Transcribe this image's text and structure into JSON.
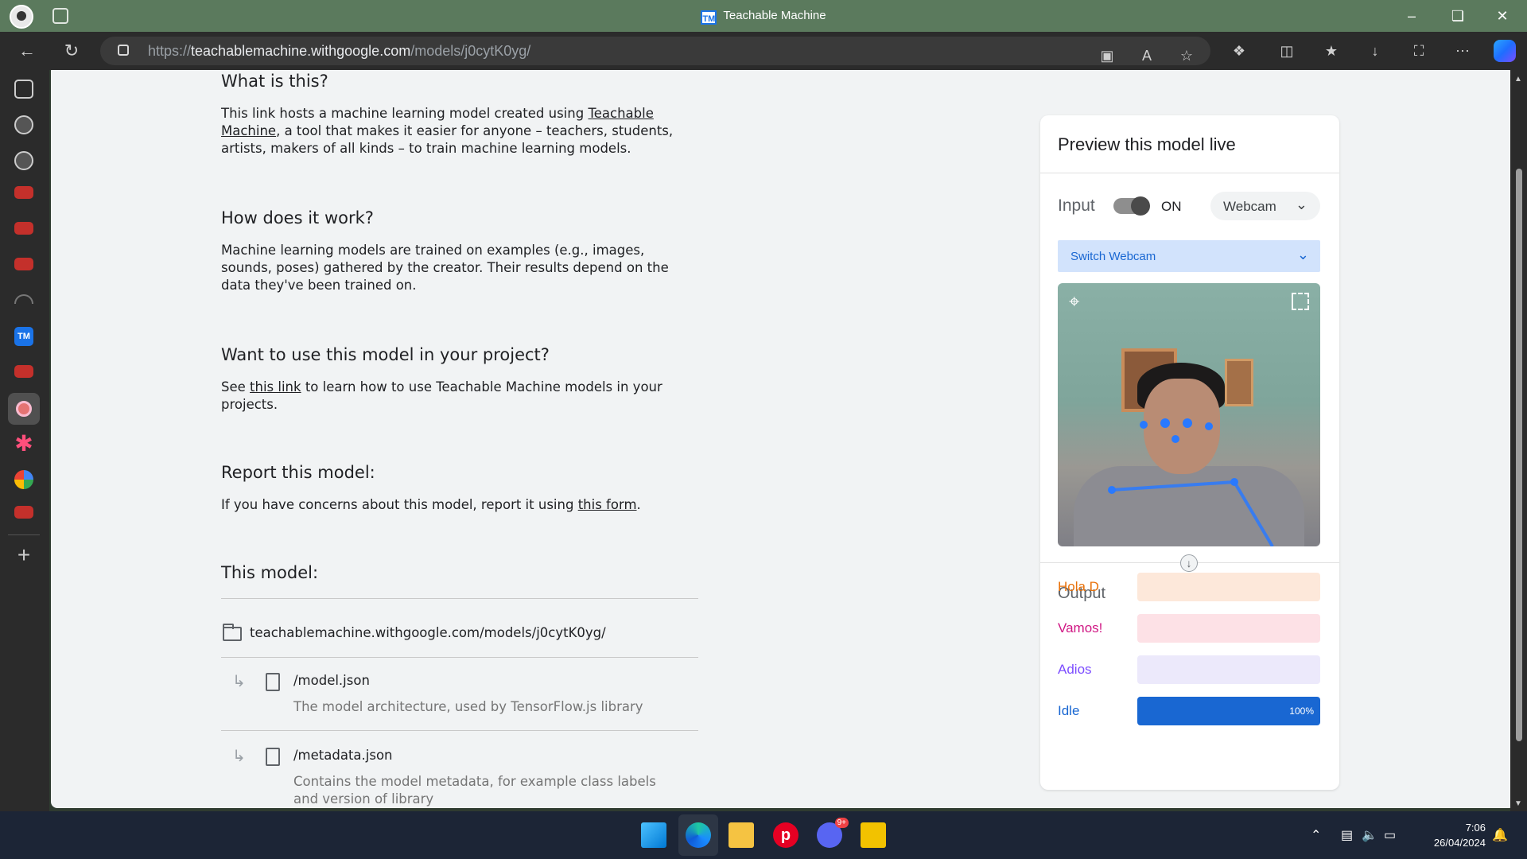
{
  "window": {
    "title": "Teachable Machine",
    "favicon_text": "TM"
  },
  "browser": {
    "url_prefix": "https://",
    "url_host": "teachablemachine.withgoogle.com",
    "url_path": "/models/j0cytK0yg/"
  },
  "sidebar": {
    "icons": [
      "collections-icon",
      "github-icon",
      "github-icon",
      "youtube-icon",
      "youtube-icon",
      "youtube-icon",
      "headphones-icon",
      "teachable-machine-icon",
      "youtube-icon",
      "record-icon",
      "asterisk-icon",
      "google-icon",
      "youtube-icon",
      "add-icon"
    ]
  },
  "content": {
    "what_heading": "What is this?",
    "what_text_1": "This link hosts a machine learning model created using ",
    "what_link": "Teachable Machine",
    "what_text_2": ", a tool that makes it easier for anyone – teachers, students, artists, makers of all kinds – to train machine learning models.",
    "how_heading": "How does it work?",
    "how_text": "Machine learning models are trained on examples (e.g., images, sounds, poses) gathered by the creator. Their results depend on the data they've been trained on.",
    "use_heading": "Want to use this model in your project?",
    "use_text_1": "See ",
    "use_link": "this link",
    "use_text_2": " to learn how to use Teachable Machine models in your projects.",
    "report_heading": "Report this model:",
    "report_text_1": "If you have concerns about this model, report it using ",
    "report_link": "this form",
    "report_text_2": ".",
    "model_heading": "This model:",
    "model_url": "teachablemachine.withgoogle.com/models/j0cytK0yg/",
    "files": [
      {
        "name": "/model.json",
        "desc": "The model architecture, used by TensorFlow.js library"
      },
      {
        "name": "/metadata.json",
        "desc": "Contains the model metadata, for example class labels and version of library"
      }
    ]
  },
  "preview": {
    "title": "Preview this model live",
    "input_label": "Input",
    "toggle_state": "ON",
    "source_select": "Webcam",
    "switch_webcam": "Switch Webcam",
    "output_label": "Output",
    "classes": [
      {
        "label": "Hola D",
        "color": "#e8710a",
        "bg": "#fde8da",
        "value": 0,
        "pct_text": ""
      },
      {
        "label": "Vamos!",
        "color": "#d01884",
        "bg": "#fde1e6",
        "value": 0,
        "pct_text": ""
      },
      {
        "label": "Adios",
        "color": "#7c4dff",
        "bg": "#ece9fb",
        "value": 0,
        "pct_text": ""
      },
      {
        "label": "Idle",
        "color": "#1967d2",
        "bg": "#1967d2",
        "value": 1.0,
        "pct_text": "100%"
      }
    ]
  },
  "taskbar": {
    "time": "7:06",
    "date": "26/04/2024",
    "discord_badge": "9+"
  }
}
